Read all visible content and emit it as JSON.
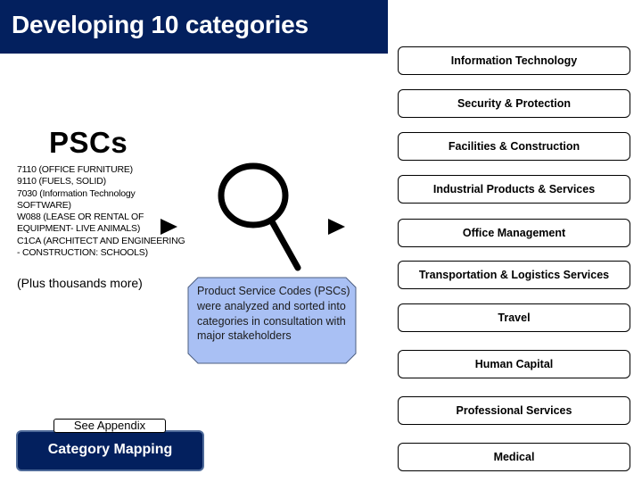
{
  "header": {
    "title": "Developing 10 categories"
  },
  "pscs": {
    "heading": "PSCs",
    "items": [
      "7110 (OFFICE FURNITURE)",
      "9110 (FUELS, SOLID)",
      "7030 (Information Technology",
      "SOFTWARE)",
      "W088 (LEASE OR RENTAL OF",
      "EQUIPMENT- LIVE ANIMALS)",
      "C1CA (ARCHITECT AND ENGINEERING",
      "- CONSTRUCTION: SCHOOLS)"
    ],
    "more_note": "(Plus thousands more)"
  },
  "process": {
    "icon": "magnifying-glass-icon",
    "callout_text": "Product Service Codes (PSCs) were analyzed and sorted into categories in consultation with major stakeholders",
    "callout_fill": "#a9c0f4",
    "callout_border": "#4d5f80"
  },
  "categories": [
    "Information Technology",
    "Security & Protection",
    "Facilities & Construction",
    "Industrial Products & Services",
    "Office Management",
    "Transportation & Logistics Services",
    "Travel",
    "Human Capital",
    "Professional Services",
    "Medical"
  ],
  "footer": {
    "appendix_label": "See Appendix",
    "mapping_button_label": "Category Mapping"
  },
  "colors": {
    "brand_navy": "#03205e"
  }
}
